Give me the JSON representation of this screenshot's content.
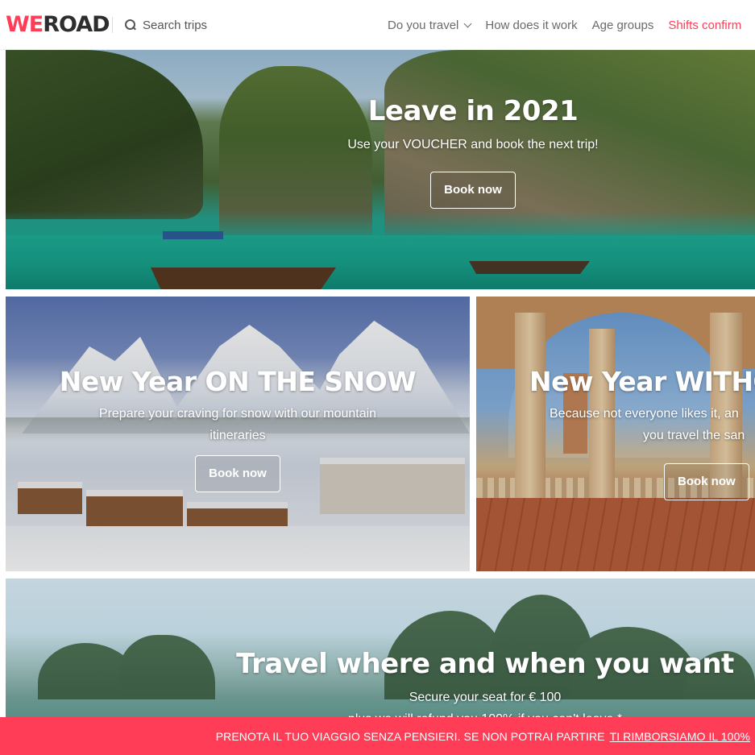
{
  "header": {
    "logo": {
      "we": "WE",
      "road": "ROAD"
    },
    "search_label": "Search trips",
    "nav": [
      {
        "label": "Do you travel",
        "has_dropdown": true
      },
      {
        "label": "How does it work"
      },
      {
        "label": "Age groups"
      },
      {
        "label": "Shifts confirm",
        "accent": true
      }
    ]
  },
  "banners": [
    {
      "title": "Leave in 2021",
      "subtitle": "Use your VOUCHER and book the next trip!",
      "button": "Book now"
    },
    {
      "title": "New Year ON THE SNOW",
      "subtitle_line1": "Prepare your craving for snow with our mountain",
      "subtitle_line2": "itineraries",
      "button": "Book now"
    },
    {
      "title": "New Year WITHO",
      "subtitle_line1": "Because not everyone likes it, an",
      "subtitle_line2": "you travel the san",
      "button": "Book now"
    },
    {
      "title": "Travel where and when you want",
      "subtitle_line1": "Secure your seat for € 100",
      "subtitle_line2": "plus we will refund you 100% if you can't leave *"
    }
  ],
  "promo": {
    "text": "PRENOTA IL TUO VIAGGIO SENZA PENSIERI. SE NON POTRAI PARTIRE",
    "link": "TI RIMBORSIAMO IL 100%"
  },
  "colors": {
    "brand": "#ff3d57",
    "nav_text": "#6a6a6a",
    "logo_dark": "#2d2d2d"
  }
}
